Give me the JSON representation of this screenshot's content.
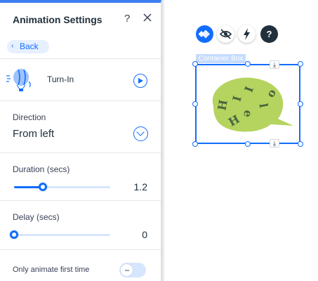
{
  "panel": {
    "title": "Animation Settings",
    "help": "?",
    "back_label": "Back",
    "animation_name": "Turn-In",
    "direction": {
      "label": "Direction",
      "value": "From left"
    },
    "duration": {
      "label": "Duration (secs)",
      "value": "1.2",
      "fraction": 0.3
    },
    "delay": {
      "label": "Delay (secs)",
      "value": "0",
      "fraction": 0.0
    },
    "animate_once": {
      "label": "Only animate first time",
      "enabled": false
    }
  },
  "canvas": {
    "container_label": "Container Box",
    "help_glyph": "?",
    "bubble_letters": [
      "H",
      "I",
      "I",
      "o",
      "l",
      "e",
      "H"
    ]
  },
  "colors": {
    "accent": "#116dff",
    "bubble": "#b5d45f",
    "text": "#20303c"
  }
}
